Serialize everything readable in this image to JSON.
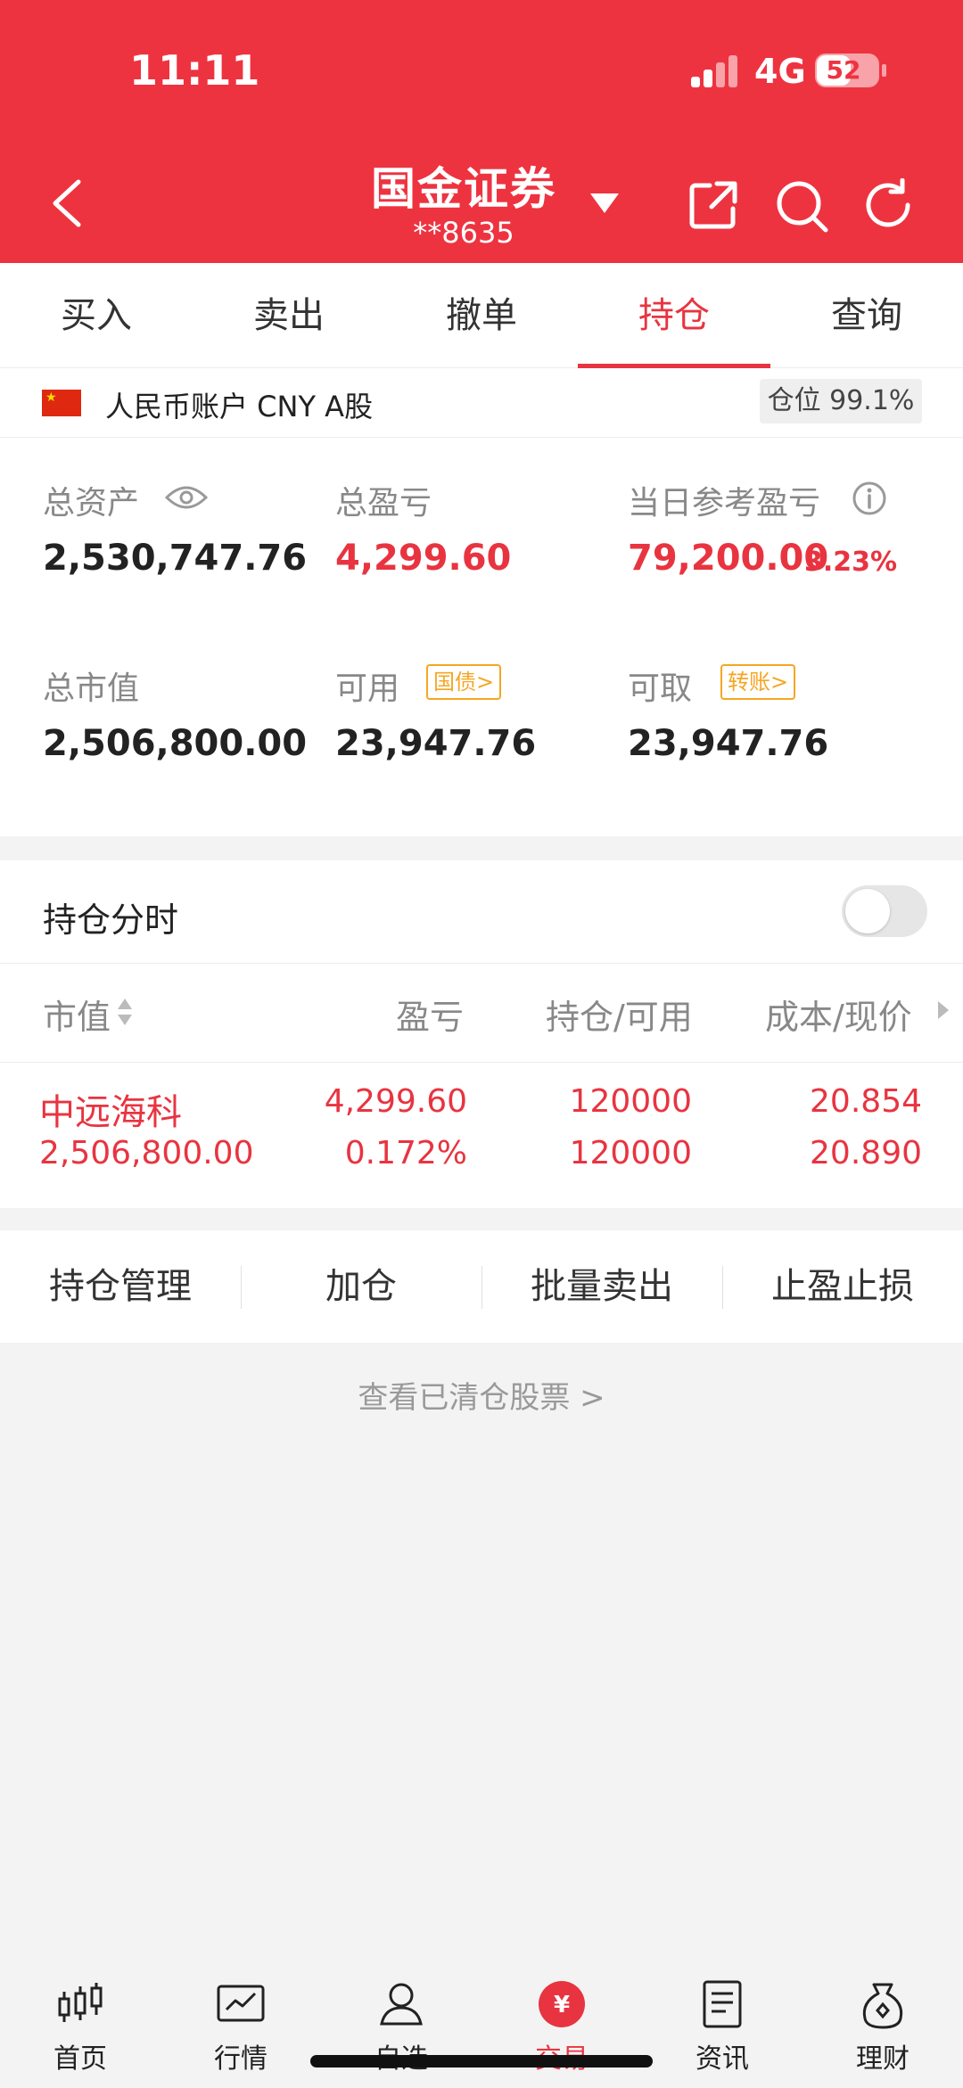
{
  "status": {
    "time": "11:11",
    "network": "4G",
    "battery": "52"
  },
  "header": {
    "title": "国金证券",
    "account": "**8635"
  },
  "tabs": [
    {
      "label": "买入"
    },
    {
      "label": "卖出"
    },
    {
      "label": "撤单"
    },
    {
      "label": "持仓",
      "active": true
    },
    {
      "label": "查询"
    }
  ],
  "account": {
    "label": "人民币账户 CNY A股",
    "position_badge": "仓位 99.1%",
    "total_assets_label": "总资产",
    "total_assets": "2,530,747.76",
    "total_pl_label": "总盈亏",
    "total_pl": "4,299.60",
    "daily_pl_label": "当日参考盈亏",
    "daily_pl": "79,200.00",
    "daily_pl_pct": "3.23%",
    "market_value_label": "总市值",
    "market_value": "2,506,800.00",
    "available_label": "可用",
    "available_tag": "国债>",
    "available": "23,947.76",
    "withdrawable_label": "可取",
    "withdrawable_tag": "转账>",
    "withdrawable": "23,947.76"
  },
  "holdings": {
    "title": "持仓分时",
    "toggle_on": false,
    "columns": [
      "市值",
      "盈亏",
      "持仓/可用",
      "成本/现价"
    ],
    "rows": [
      {
        "name": "中远海科",
        "market_value": "2,506,800.00",
        "pl": "4,299.60",
        "pl_pct": "0.172%",
        "position": "120000",
        "available": "120000",
        "cost": "20.854",
        "price": "20.890"
      }
    ]
  },
  "actions": [
    "持仓管理",
    "加仓",
    "批量卖出",
    "止盈止损"
  ],
  "cleared_link": "查看已清仓股票 >",
  "nav": [
    {
      "label": "首页",
      "icon": "candlestick-icon"
    },
    {
      "label": "行情",
      "icon": "chart-icon"
    },
    {
      "label": "自选",
      "icon": "user-icon"
    },
    {
      "label": "交易",
      "icon": "yuan-icon",
      "active": true
    },
    {
      "label": "资讯",
      "icon": "document-icon"
    },
    {
      "label": "理财",
      "icon": "money-bag-icon"
    }
  ],
  "colors": {
    "brand_red": "#ee3340",
    "up_red": "#e83440",
    "tag_orange": "#f5a623"
  }
}
